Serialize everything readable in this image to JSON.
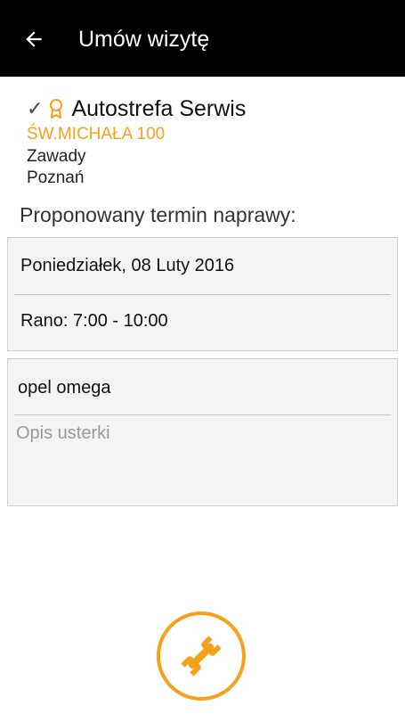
{
  "appbar": {
    "title": "Umów wizytę"
  },
  "shop": {
    "name": "Autostrefa Serwis",
    "street": "ŚW.MICHAŁA 100",
    "district": "Zawady",
    "city": "Poznań"
  },
  "proposed_label": "Proponowany termin naprawy:",
  "schedule": {
    "date": "Poniedziałek, 08 Luty 2016",
    "time": "Rano: 7:00 - 10:00"
  },
  "form": {
    "car": "opel omega",
    "fault_placeholder": "Opis usterki"
  },
  "colors": {
    "accent": "#f5a11c",
    "appbar": "#000000",
    "card": "#f4f4f4"
  },
  "icons": {
    "back": "arrow-left-icon",
    "verified": "check-icon",
    "award": "award-icon",
    "fab": "wrench-icon"
  }
}
